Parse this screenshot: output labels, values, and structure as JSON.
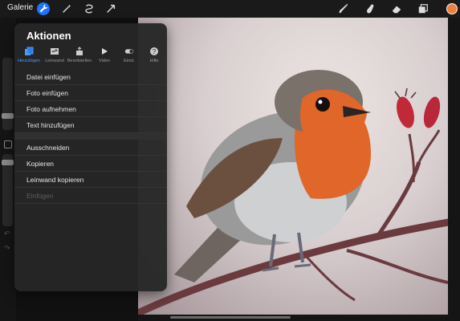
{
  "toolbar": {
    "gallery_label": "Galerie",
    "left_icons": [
      "wrench-icon",
      "magic-wand-icon",
      "selection-icon",
      "transform-arrow-icon"
    ],
    "right_icons": [
      "brush-icon",
      "smudge-icon",
      "eraser-icon",
      "layers-icon"
    ],
    "active_color": "#ef7f3b",
    "accent": "#1e73ff"
  },
  "actions": {
    "title": "Aktionen",
    "tabs": [
      {
        "label": "Hinzufügen",
        "icon": "add-file-icon",
        "active": true
      },
      {
        "label": "Leinwand",
        "icon": "canvas-icon",
        "active": false
      },
      {
        "label": "Bereitstellen",
        "icon": "share-icon",
        "active": false
      },
      {
        "label": "Video",
        "icon": "play-icon",
        "active": false
      },
      {
        "label": "Einst.",
        "icon": "toggle-icon",
        "active": false
      },
      {
        "label": "Hilfe",
        "icon": "help-icon",
        "active": false
      }
    ],
    "group1": [
      "Datei einfügen",
      "Foto einfügen",
      "Foto aufnehmen",
      "Text hinzufügen"
    ],
    "group2": [
      "Ausschneiden",
      "Kopieren",
      "Leinwand kopieren",
      "Einfügen"
    ],
    "disabled_item": "Einfügen"
  },
  "canvas": {
    "subject": "robin-illustration",
    "colors": {
      "background": "#ddd3d3",
      "breast": "#e0662a",
      "branch": "#6a3a3f",
      "berries": "#c02a38"
    }
  }
}
